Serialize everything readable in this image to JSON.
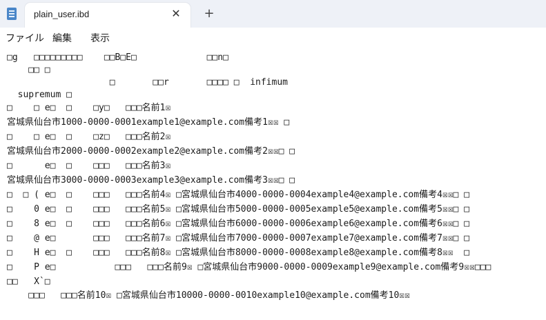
{
  "window": {
    "tab_title": "plain_user.ibd",
    "close_glyph": "✕",
    "new_tab_glyph": "+"
  },
  "menu": {
    "file": "ファイル",
    "edit": "編集",
    "view": "表示"
  },
  "editor": {
    "lines": [
      " ",
      "□g   □□□□□□□□□    □□B□E□             □□n□",
      "    □□ □",
      "                   □       □□r       □□□□ □  infimum",
      "  supremum □",
      "□    □ e□  □    □y□   □□□名前1☒",
      "宮城県仙台市1000-0000-0001example1@example.com備考1☒☒ □",
      "□    □ e□  □    □z□   □□□名前2☒",
      "宮城県仙台市2000-0000-0002example2@example.com備考2☒☒□ □",
      "□      e□  □    □□□   □□□名前3☒",
      "宮城県仙台市3000-0000-0003example3@example.com備考3☒☒□ □",
      "□  □ ( e□  □    □□□   □□□名前4☒ □宮城県仙台市4000-0000-0004example4@example.com備考4☒☒□ □",
      "□    0 e□  □    □□□   □□□名前5☒ □宮城県仙台市5000-0000-0005example5@example.com備考5☒☒□ □",
      "□    8 e□  □    □□□   □□□名前6☒ □宮城県仙台市6000-0000-0006example6@example.com備考6☒☒□ □",
      "□    @ e□       □□□   □□□名前7☒ □宮城県仙台市7000-0000-0007example7@example.com備考7☒☒□ □",
      "□    H e□  □    □□□   □□□名前8☒ □宮城県仙台市8000-0000-0008example8@example.com備考8☒☒  □",
      "□    P e□           □□□   □□□名前9☒ □宮城県仙台市9000-0000-0009example9@example.com備考9☒☒□□□",
      "□□   X`□",
      "    □□□   □□□名前10☒ □宮城県仙台市10000-0000-0010example10@example.com備考10☒☒"
    ]
  }
}
